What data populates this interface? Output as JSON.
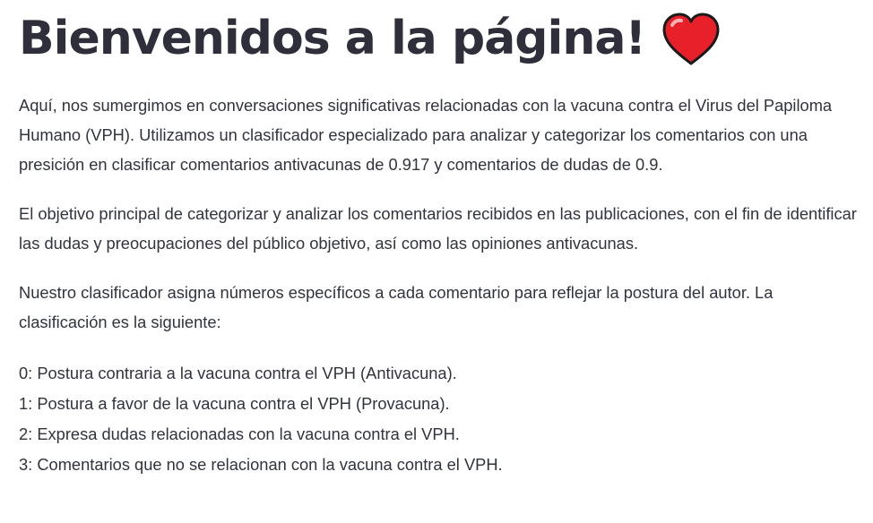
{
  "header": {
    "title": "Bienvenidos a la página!",
    "emoji_icon": "red-heart-icon",
    "heart_color": "#e8202a"
  },
  "content": {
    "paragraphs": [
      "Aquí, nos sumergimos en conversaciones significativas relacionadas con la vacuna contra el Virus del Papiloma Humano (VPH). Utilizamos un clasificador especializado para analizar y categorizar los comentarios con una presición en clasificar comentarios antivacunas de 0.917 y comentarios de dudas de 0.9.",
      "El objetivo principal de categorizar y analizar los comentarios recibidos en las publicaciones, con el fin de identificar las dudas y preocupaciones del público objetivo, así como las opiniones antivacunas.",
      "Nuestro clasificador asigna números específicos a cada comentario para reflejar la postura del autor. La clasificación es la siguiente:"
    ],
    "classes": [
      "0: Postura contraria a la vacuna contra el VPH (Antivacuna).",
      "1: Postura a favor de la vacuna contra el VPH (Provacuna).",
      "2: Expresa dudas relacionadas con la vacuna contra el VPH.",
      "3: Comentarios que no se relacionan con la vacuna contra el VPH."
    ]
  },
  "colors": {
    "text": "#31333f",
    "background": "#ffffff"
  }
}
